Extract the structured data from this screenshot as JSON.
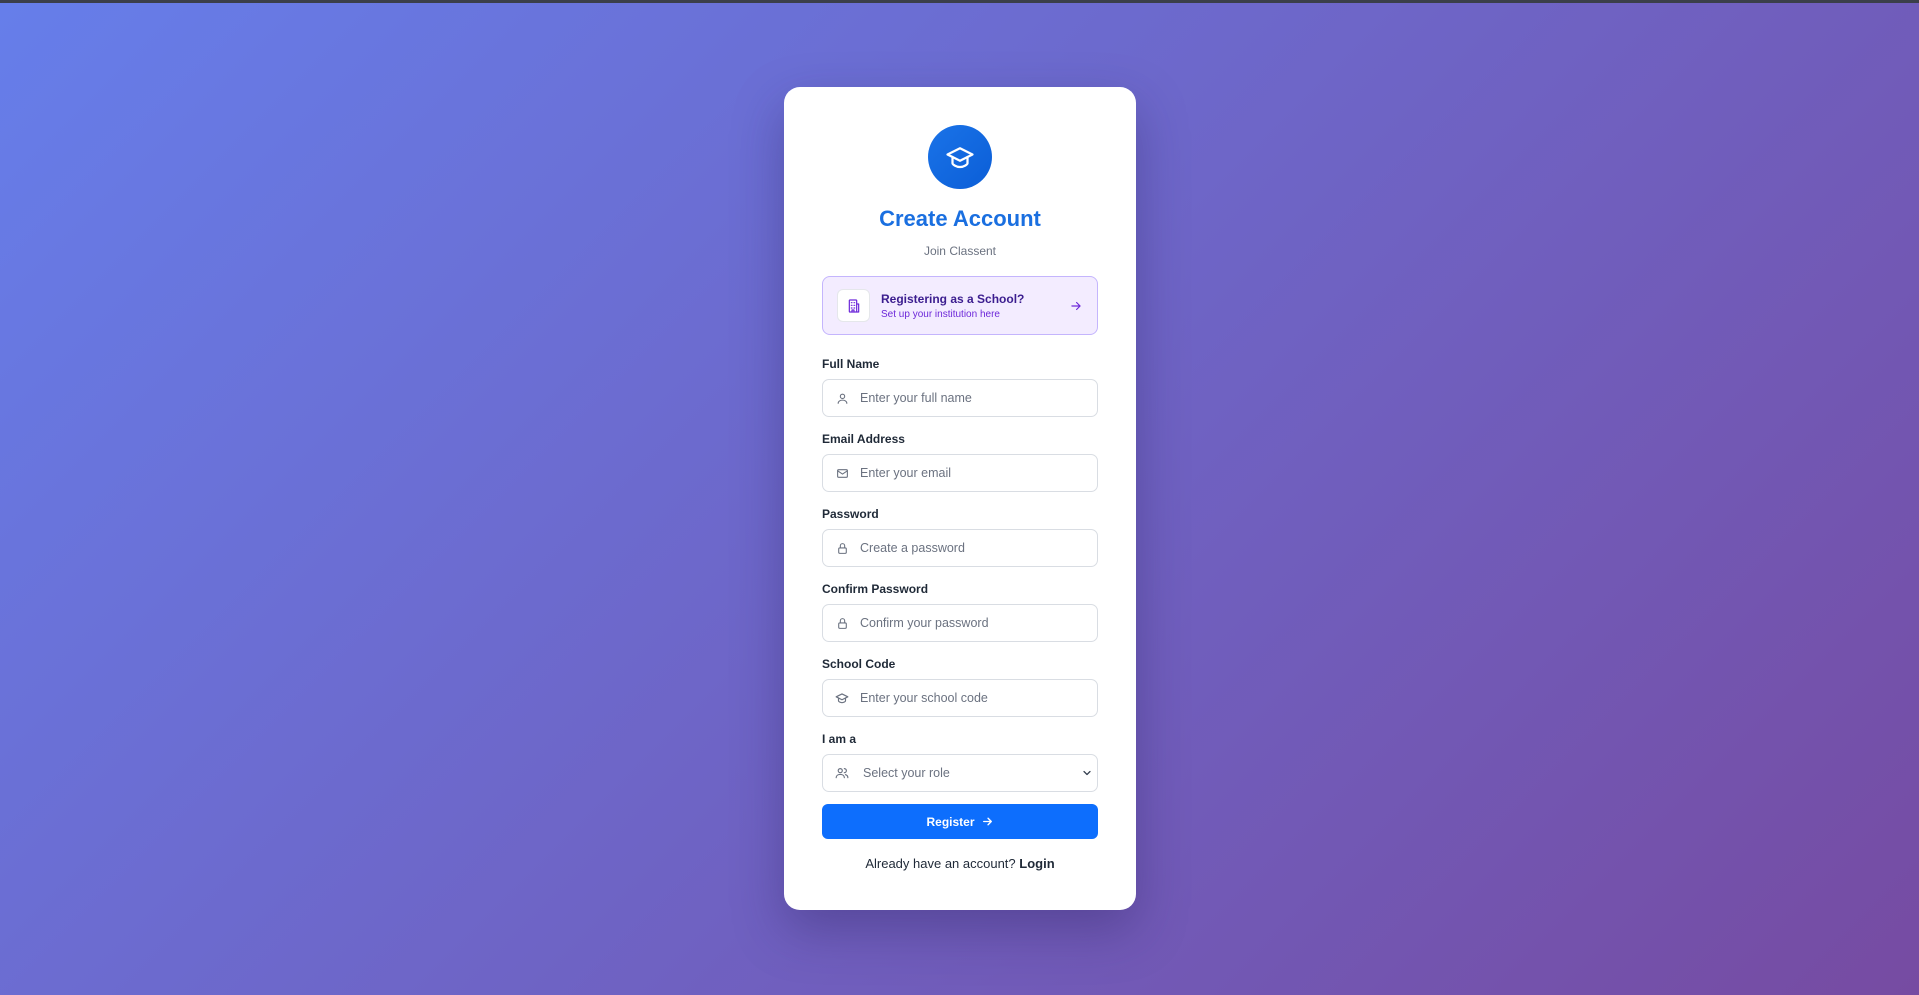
{
  "header": {
    "logo_icon": "graduation-cap-icon",
    "title": "Create Account",
    "subtitle": "Join Classent"
  },
  "school_banner": {
    "icon": "building-icon",
    "title": "Registering as a School?",
    "subtitle": "Set up your institution here",
    "arrow_icon": "arrow-right-icon"
  },
  "form": {
    "full_name": {
      "label": "Full Name",
      "placeholder": "Enter your full name",
      "value": "",
      "icon": "user-icon"
    },
    "email": {
      "label": "Email Address",
      "placeholder": "Enter your email",
      "value": "",
      "icon": "mail-icon"
    },
    "password": {
      "label": "Password",
      "placeholder": "Create a password",
      "value": "",
      "icon": "lock-icon"
    },
    "confirm_password": {
      "label": "Confirm Password",
      "placeholder": "Confirm your password",
      "value": "",
      "icon": "lock-icon"
    },
    "school_code": {
      "label": "School Code",
      "placeholder": "Enter your school code",
      "value": "",
      "icon": "graduation-cap-icon"
    },
    "role": {
      "label": "I am a",
      "selected": "Select your role",
      "icon": "users-icon"
    }
  },
  "register_button": {
    "label": "Register",
    "icon": "arrow-right-icon"
  },
  "footer": {
    "prompt": "Already have an account?",
    "login_label": "Login"
  },
  "colors": {
    "accent": "#0d6efd",
    "title": "#1a6fe0",
    "banner_bg": "#f3ecff",
    "banner_border": "#c4b5fd",
    "background_start": "#667eea",
    "background_end": "#764ba2"
  }
}
